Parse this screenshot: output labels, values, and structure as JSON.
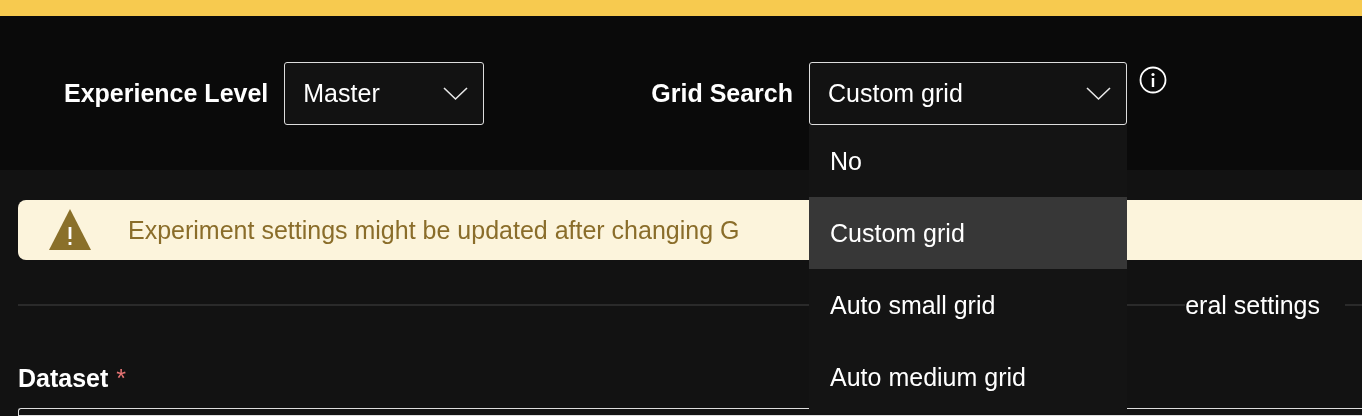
{
  "header": {
    "fields": [
      {
        "label": "Experience Level",
        "value": "Master"
      },
      {
        "label": "Grid Search",
        "value": "Custom grid",
        "info": true,
        "options": [
          {
            "label": "No",
            "selected": false
          },
          {
            "label": "Custom grid",
            "selected": true
          },
          {
            "label": "Auto small grid",
            "selected": false
          },
          {
            "label": "Auto medium grid",
            "selected": false
          }
        ]
      }
    ]
  },
  "warning": {
    "text": "Experiment settings might be updated after changing G"
  },
  "section": {
    "title": "eral settings"
  },
  "dataset": {
    "label": "Dataset",
    "required": true,
    "required_mark": "*"
  }
}
